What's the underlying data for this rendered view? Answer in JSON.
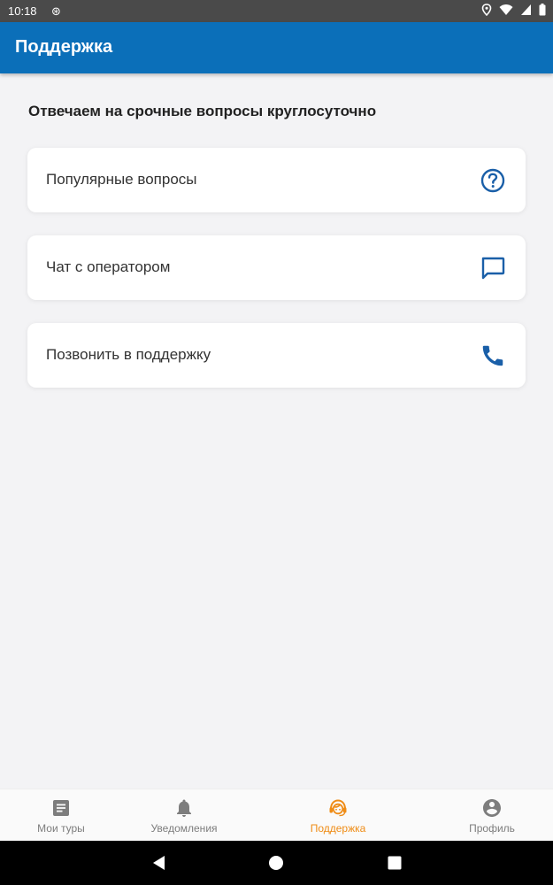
{
  "status_bar": {
    "time": "10:18",
    "sync_glyph": "⊛"
  },
  "app_bar": {
    "title": "Поддержка"
  },
  "main": {
    "headline": "Отвечаем на срочные вопросы круглосуточно",
    "cards": [
      {
        "label": "Популярные вопросы",
        "icon": "help-circle-icon"
      },
      {
        "label": "Чат с оператором",
        "icon": "chat-icon"
      },
      {
        "label": "Позвонить в поддержку",
        "icon": "phone-icon"
      }
    ]
  },
  "bottom_nav": {
    "items": [
      {
        "label": "Мои туры",
        "icon": "document-icon",
        "active": false
      },
      {
        "label": "Уведомления",
        "icon": "bell-icon",
        "active": false
      },
      {
        "label": "Поддержка",
        "icon": "support-agent-icon",
        "active": true
      },
      {
        "label": "Профиль",
        "icon": "account-circle-icon",
        "active": false
      }
    ]
  },
  "colors": {
    "app_bar": "#0b6fb9",
    "icon_blue": "#1a5fa8",
    "active_nav": "#ef8c16",
    "inactive_nav": "#7d7d7d",
    "background": "#f3f3f5"
  }
}
